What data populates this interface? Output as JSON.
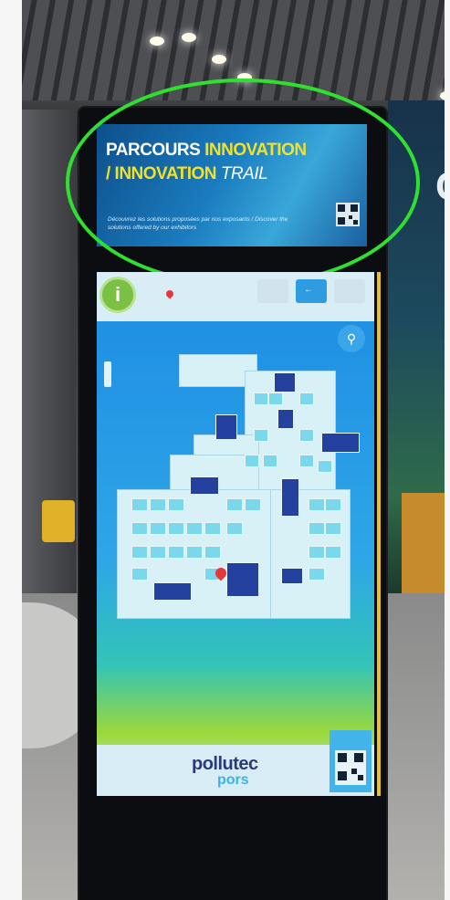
{
  "top_display": {
    "title_part1": "PARCOURS",
    "title_part2": "INNOVATION",
    "title_line2_part1": "/ INNOVATION",
    "title_line2_part2": "TRAIL",
    "subtitle": "Découvrez les solutions proposées par nos exposants / Discover the solutions offered by our exhibitors"
  },
  "main_display": {
    "info_button_label": "i",
    "search_icon": "search-icon",
    "logo_text_1": "pollutec",
    "logo_text_2": "pors"
  },
  "booth": {
    "letter": "C"
  },
  "colors": {
    "highlight_circle": "#2fe030",
    "accent_yellow": "#f2e12a",
    "map_blue": "#2441a0",
    "stand_cyan": "#7ad7ec"
  }
}
